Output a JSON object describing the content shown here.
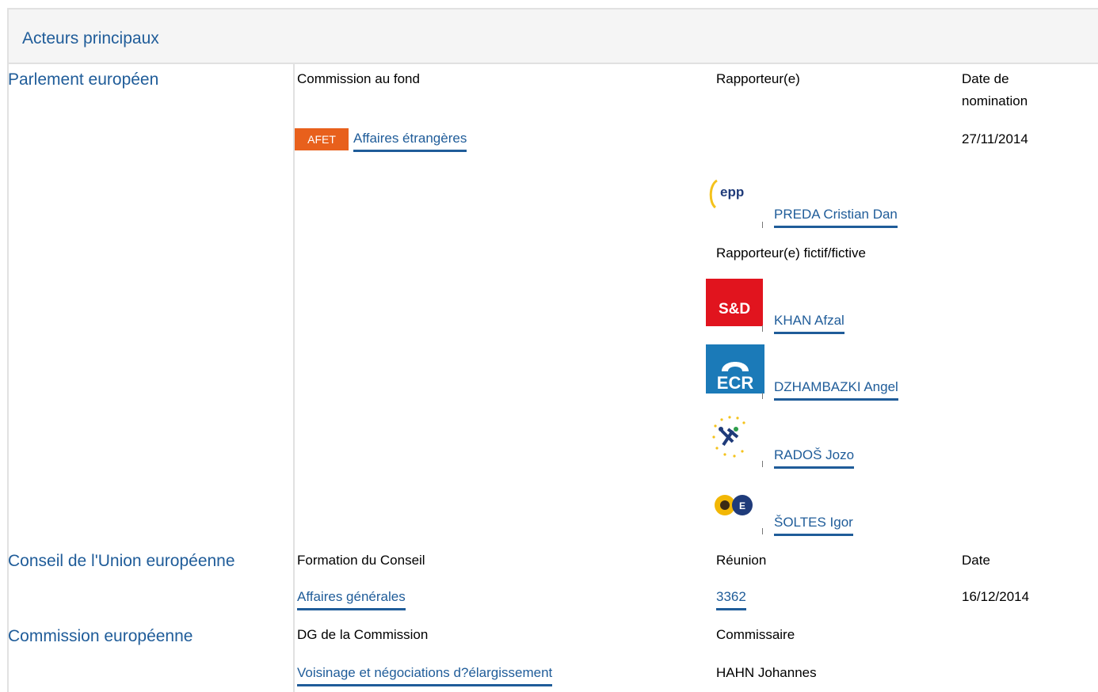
{
  "header": {
    "title": "Acteurs principaux"
  },
  "parliament": {
    "section": "Parlement européen",
    "col_committee": "Commission au fond",
    "col_rapporteur": "Rapporteur(e)",
    "col_date": "Date de nomination",
    "committee_badge": "AFET",
    "committee_name": "Affaires étrangères",
    "nomination_date": "27/11/2014",
    "rapporteur": {
      "name": "PREDA Cristian Dan",
      "group_logo": "epp-logo"
    },
    "shadow_label": "Rapporteur(e) fictif/fictive",
    "shadows": [
      {
        "name": "KHAN Afzal",
        "group_logo": "sd-logo"
      },
      {
        "name": "DZHAMBAZKI Angel",
        "group_logo": "ecr-logo"
      },
      {
        "name": "RADOŠ Jozo",
        "group_logo": "alde-logo"
      },
      {
        "name": "ŠOLTES Igor",
        "group_logo": "greens-efa-logo"
      }
    ],
    "logo_texts": {
      "epp": "epp",
      "sd": "S&D",
      "ecr": "ECR"
    }
  },
  "council": {
    "section": "Conseil de l'Union européenne",
    "col_formation": "Formation du Conseil",
    "col_meeting": "Réunion",
    "col_date": "Date",
    "formation": "Affaires générales",
    "meeting": "3362",
    "date": "16/12/2014"
  },
  "commission": {
    "section": "Commission européenne",
    "col_dg": "DG de la Commission",
    "col_commissioner": "Commissaire",
    "dg": "Voisinage et négociations d?élargissement",
    "commissioner": "HAHN Johannes"
  },
  "colors": {
    "link": "#1f5c99",
    "badge": "#e8601c",
    "header_bg": "#f5f5f5"
  }
}
